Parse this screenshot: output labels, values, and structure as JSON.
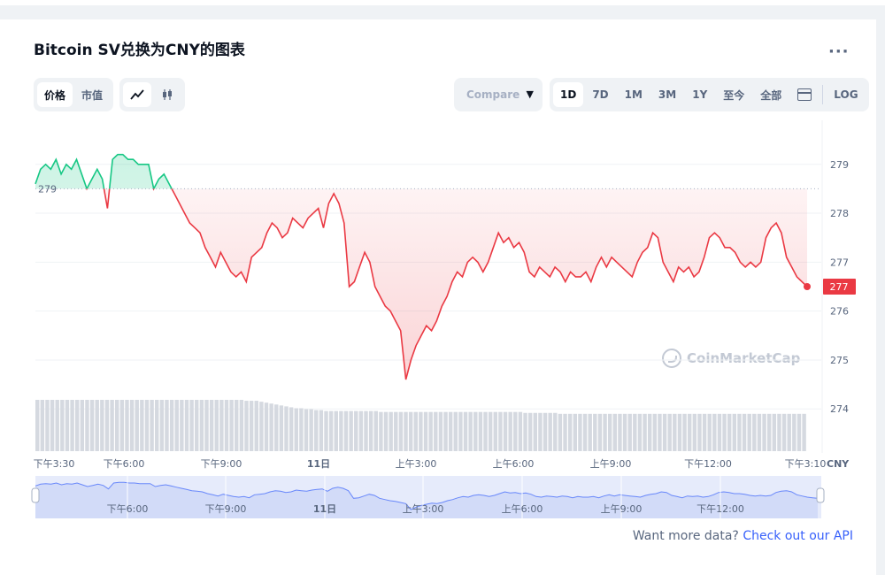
{
  "title": "Bitcoin SV兑换为CNY的图表",
  "toolbar": {
    "price_tab": "价格",
    "marketcap_tab": "市值",
    "line_icon": "line-chart-icon",
    "candle_icon": "candlestick-icon",
    "compare_label": "Compare",
    "ranges": [
      "1D",
      "7D",
      "1M",
      "3M",
      "1Y",
      "至今",
      "全部"
    ],
    "calendar_icon": "calendar-icon",
    "log_label": "LOG",
    "active_range": "1D"
  },
  "watermark": "CoinMarketCap",
  "footer": {
    "text": "Want more data?",
    "link": "Check out our API"
  },
  "colors": {
    "up": "#16c784",
    "down": "#ea3943",
    "volume": "#d5d9e0",
    "navigator": "#3861fb"
  },
  "chart_data": {
    "type": "area",
    "currency_label": "CNY",
    "baseline": 278.5,
    "baseline_label": "279",
    "last_price_label": "277",
    "ylim": [
      273.1,
      279.9
    ],
    "yticks": [
      274,
      275,
      276,
      277,
      278,
      279
    ],
    "xticks": [
      "下午3:30",
      "下午6:00",
      "下午9:00",
      "11日",
      "上午3:00",
      "上午6:00",
      "上午9:00",
      "下午12:00",
      "下午3:10"
    ],
    "navigator_ticks": [
      "下午6:00",
      "下午9:00",
      "11日",
      "上午3:00",
      "上午6:00",
      "上午9:00",
      "下午12:00"
    ],
    "price": [
      278.6,
      278.9,
      279.0,
      278.9,
      279.1,
      278.8,
      279.0,
      278.9,
      279.1,
      278.8,
      278.5,
      278.7,
      278.9,
      278.7,
      278.1,
      279.1,
      279.2,
      279.2,
      279.1,
      279.1,
      279.0,
      279.0,
      279.0,
      278.5,
      278.7,
      278.8,
      278.6,
      278.4,
      278.2,
      278.0,
      277.8,
      277.7,
      277.6,
      277.3,
      277.1,
      276.9,
      277.2,
      277.0,
      276.8,
      276.7,
      276.8,
      276.6,
      277.1,
      277.2,
      277.3,
      277.6,
      277.8,
      277.7,
      277.5,
      277.6,
      277.9,
      277.8,
      277.7,
      277.9,
      278.0,
      278.1,
      277.7,
      278.2,
      278.4,
      278.2,
      277.8,
      276.5,
      276.6,
      276.9,
      277.2,
      277.0,
      276.5,
      276.3,
      276.1,
      276.0,
      275.8,
      275.6,
      274.6,
      275.0,
      275.3,
      275.5,
      275.7,
      275.6,
      275.8,
      276.1,
      276.3,
      276.6,
      276.8,
      276.7,
      277.0,
      277.1,
      277.0,
      276.8,
      277.0,
      277.3,
      277.6,
      277.4,
      277.5,
      277.3,
      277.4,
      277.2,
      276.8,
      276.7,
      276.9,
      276.8,
      276.7,
      276.9,
      276.8,
      276.6,
      276.8,
      276.7,
      276.7,
      276.8,
      276.6,
      276.9,
      277.1,
      276.9,
      277.1,
      277.0,
      276.9,
      276.8,
      276.7,
      277.0,
      277.2,
      277.3,
      277.6,
      277.5,
      277.0,
      276.8,
      276.6,
      276.9,
      276.8,
      276.9,
      276.7,
      276.8,
      277.1,
      277.5,
      277.6,
      277.5,
      277.3,
      277.3,
      277.2,
      277.0,
      276.9,
      277.0,
      276.9,
      277.0,
      277.5,
      277.7,
      277.8,
      277.6,
      277.1,
      276.9,
      276.7,
      276.6,
      276.5
    ],
    "volume": [
      0.55,
      0.55,
      0.55,
      0.55,
      0.55,
      0.55,
      0.55,
      0.55,
      0.55,
      0.55,
      0.55,
      0.55,
      0.55,
      0.55,
      0.55,
      0.55,
      0.55,
      0.55,
      0.55,
      0.55,
      0.55,
      0.55,
      0.55,
      0.55,
      0.55,
      0.55,
      0.55,
      0.55,
      0.55,
      0.55,
      0.55,
      0.55,
      0.55,
      0.55,
      0.55,
      0.55,
      0.55,
      0.55,
      0.55,
      0.55,
      0.55,
      0.55,
      0.54,
      0.54,
      0.54,
      0.53,
      0.52,
      0.51,
      0.5,
      0.49,
      0.48,
      0.47,
      0.46,
      0.46,
      0.45,
      0.45,
      0.44,
      0.44,
      0.43,
      0.43,
      0.43,
      0.43,
      0.43,
      0.43,
      0.43,
      0.43,
      0.43,
      0.43,
      0.43,
      0.42,
      0.42,
      0.42,
      0.42,
      0.42,
      0.42,
      0.42,
      0.42,
      0.42,
      0.42,
      0.42,
      0.42,
      0.42,
      0.42,
      0.42,
      0.42,
      0.42,
      0.42,
      0.42,
      0.42,
      0.42,
      0.42,
      0.42,
      0.42,
      0.42,
      0.42,
      0.42,
      0.42,
      0.42,
      0.41,
      0.41,
      0.41,
      0.41,
      0.41,
      0.41,
      0.41,
      0.4,
      0.4,
      0.4,
      0.4,
      0.4,
      0.4,
      0.4,
      0.4,
      0.4,
      0.4,
      0.4,
      0.4,
      0.4,
      0.4,
      0.4,
      0.4,
      0.4,
      0.4,
      0.4,
      0.4,
      0.4,
      0.4,
      0.4,
      0.4,
      0.4,
      0.4,
      0.4,
      0.4,
      0.4,
      0.4,
      0.4,
      0.4,
      0.4,
      0.4,
      0.4,
      0.4,
      0.4,
      0.4,
      0.4,
      0.4,
      0.4,
      0.4,
      0.4,
      0.4,
      0.4,
      0.4,
      0.4,
      0.4,
      0.4,
      0.4
    ]
  }
}
